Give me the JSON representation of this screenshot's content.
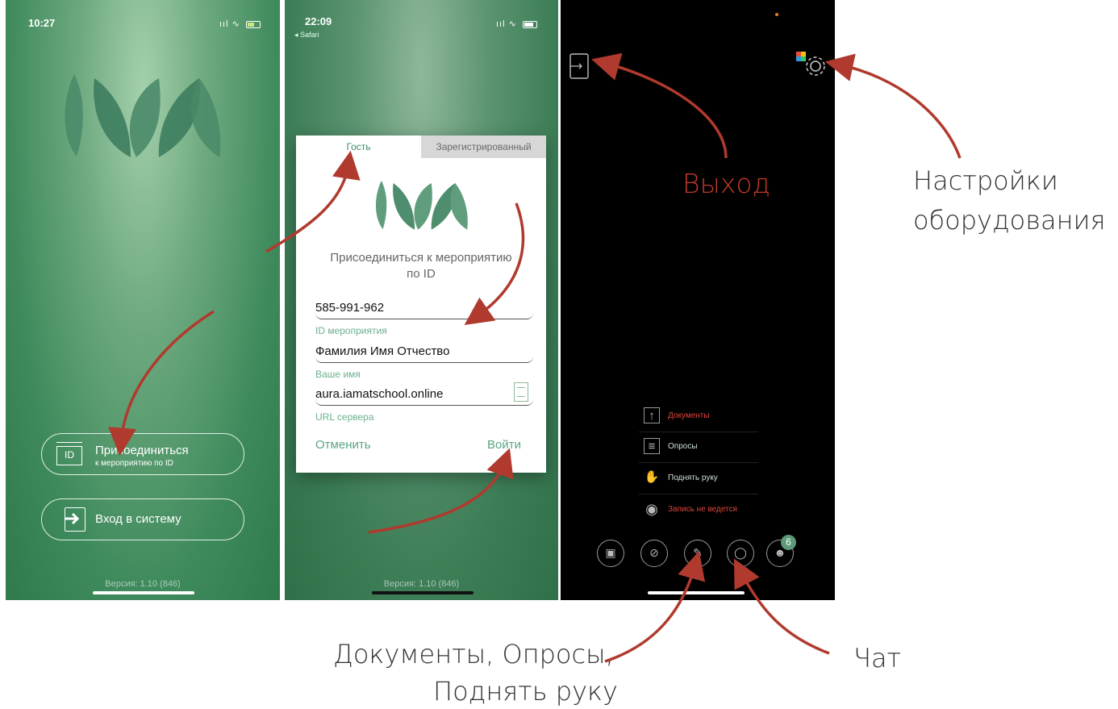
{
  "screen_join": {
    "status": {
      "time": "10:27",
      "signal": "ııl"
    },
    "join_button": {
      "badge": "ID",
      "title": "Присоединиться",
      "subtitle": "к мероприятию по ID"
    },
    "login_button": {
      "label": "Вход в систему"
    },
    "version": "Версия: 1.10 (846)"
  },
  "screen_dialog": {
    "status": {
      "time": "22:09",
      "back": "◂ Safari",
      "signal": "ııl"
    },
    "tabs": [
      "Гость",
      "Зарегистрированный"
    ],
    "title": [
      "Присоединиться к мероприятию",
      "по ID"
    ],
    "fields": [
      {
        "value": "585-991-962",
        "label": "ID мероприятия"
      },
      {
        "value": "Фамилия Имя Отчество",
        "label": "Ваше имя"
      },
      {
        "value": "aura.iamatschool.online",
        "label": "URL сервера"
      }
    ],
    "cancel_label": "Отменить",
    "login_label": "Войти",
    "version": "Версия: 1.10 (846)"
  },
  "screen_meeting": {
    "menu": [
      {
        "label": "Документы",
        "icon": "upload-icon",
        "color": "#e0443a"
      },
      {
        "label": "Опросы",
        "icon": "list-icon",
        "color": "#cfe0d4"
      },
      {
        "label": "Поднять руку",
        "icon": "hand-icon",
        "color": "#cfe0d4"
      },
      {
        "label": "Запись не ведется",
        "icon": "record-icon",
        "color": "#e0443a"
      }
    ],
    "participants_count": "6",
    "toolbar": [
      "camera-off-icon",
      "mic-off-icon",
      "edit-icon",
      "chat-icon",
      "participants-icon"
    ]
  },
  "annotations": {
    "exit": "Выход",
    "settings": [
      "Настройки",
      "оборудования"
    ],
    "docs": [
      "Документы, Опросы,",
      "Поднять руку"
    ],
    "chat": "Чат"
  },
  "colors": {
    "accent_red": "#c0392b",
    "brand_green": "#3f8d67",
    "arrow": "#b03a2e"
  }
}
